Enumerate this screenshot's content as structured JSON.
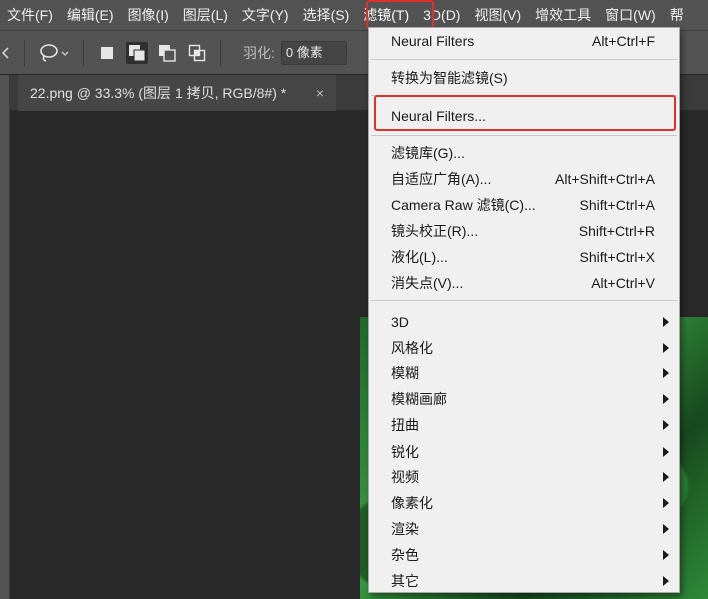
{
  "menubar": {
    "items": [
      {
        "label": "文件(F)"
      },
      {
        "label": "编辑(E)"
      },
      {
        "label": "图像(I)"
      },
      {
        "label": "图层(L)"
      },
      {
        "label": "文字(Y)"
      },
      {
        "label": "选择(S)"
      },
      {
        "label": "滤镜(T)"
      },
      {
        "label": "3D(D)"
      },
      {
        "label": "视图(V)"
      },
      {
        "label": "增效工具"
      },
      {
        "label": "窗口(W)"
      },
      {
        "label": "帮"
      }
    ]
  },
  "options": {
    "feather_label": "羽化:",
    "feather_value": "0 像素"
  },
  "document_tab": {
    "title": "22.png @ 33.3% (图层 1 拷贝, RGB/8#) *",
    "close": "×"
  },
  "filter_menu": {
    "items": [
      {
        "label": "Neural Filters",
        "shortcut": "Alt+Ctrl+F"
      },
      {
        "label": "转换为智能滤镜(S)",
        "shortcut": ""
      },
      {
        "label": "Neural Filters...",
        "shortcut": ""
      },
      {
        "label": "滤镜库(G)...",
        "shortcut": ""
      },
      {
        "label": "自适应广角(A)...",
        "shortcut": "Alt+Shift+Ctrl+A"
      },
      {
        "label": "Camera Raw 滤镜(C)...",
        "shortcut": "Shift+Ctrl+A"
      },
      {
        "label": "镜头校正(R)...",
        "shortcut": "Shift+Ctrl+R"
      },
      {
        "label": "液化(L)...",
        "shortcut": "Shift+Ctrl+X"
      },
      {
        "label": "消失点(V)...",
        "shortcut": "Alt+Ctrl+V"
      },
      {
        "label": "3D",
        "shortcut": ""
      },
      {
        "label": "风格化",
        "shortcut": ""
      },
      {
        "label": "模糊",
        "shortcut": ""
      },
      {
        "label": "模糊画廊",
        "shortcut": ""
      },
      {
        "label": "扭曲",
        "shortcut": ""
      },
      {
        "label": "锐化",
        "shortcut": ""
      },
      {
        "label": "视频",
        "shortcut": ""
      },
      {
        "label": "像素化",
        "shortcut": ""
      },
      {
        "label": "渲染",
        "shortcut": ""
      },
      {
        "label": "杂色",
        "shortcut": ""
      },
      {
        "label": "其它",
        "shortcut": ""
      }
    ]
  },
  "colors": {
    "highlight": "#e0302a",
    "menubar_bg": "#535353",
    "menu_bg": "#f0f0f0"
  }
}
